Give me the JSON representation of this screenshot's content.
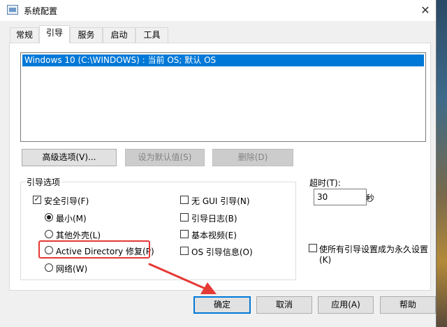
{
  "window": {
    "title": "系统配置",
    "close_glyph": "✕"
  },
  "tabs": [
    {
      "label": "常规",
      "active": false
    },
    {
      "label": "引导",
      "active": true
    },
    {
      "label": "服务",
      "active": false
    },
    {
      "label": "启动",
      "active": false
    },
    {
      "label": "工具",
      "active": false
    }
  ],
  "os_list": {
    "items": [
      "Windows 10 (C:\\WINDOWS) : 当前 OS; 默认 OS"
    ],
    "selected_index": 0
  },
  "list_buttons": {
    "advanced": "高级选项(V)...",
    "set_default": "设为默认值(S)",
    "delete": "删除(D)"
  },
  "boot_options": {
    "group_label": "引导选项",
    "safe_boot": {
      "label": "安全引导(F)",
      "checked": true
    },
    "safe_modes": [
      {
        "label": "最小(M)",
        "selected": true
      },
      {
        "label": "其他外壳(L)",
        "selected": false
      },
      {
        "label": "Active Directory 修复(P)",
        "selected": false
      },
      {
        "label": "网络(W)",
        "selected": false
      }
    ],
    "no_gui": {
      "label": "无 GUI 引导(N)",
      "checked": false
    },
    "boot_log": {
      "label": "引导日志(B)",
      "checked": false
    },
    "base_video": {
      "label": "基本视频(E)",
      "checked": false
    },
    "os_boot_info": {
      "label": "OS 引导信息(O)",
      "checked": false
    }
  },
  "timeout": {
    "label": "超时(T):",
    "value": "30",
    "unit": "秒"
  },
  "make_permanent": {
    "label_line1": "使所有引导设置成为永久设置",
    "label_line2": "(K)",
    "checked": false
  },
  "footer_buttons": {
    "ok": "确定",
    "cancel": "取消",
    "apply": "应用(A)",
    "help": "帮助"
  },
  "colors": {
    "selection": "#0078d7",
    "annotation": "#e53935"
  }
}
